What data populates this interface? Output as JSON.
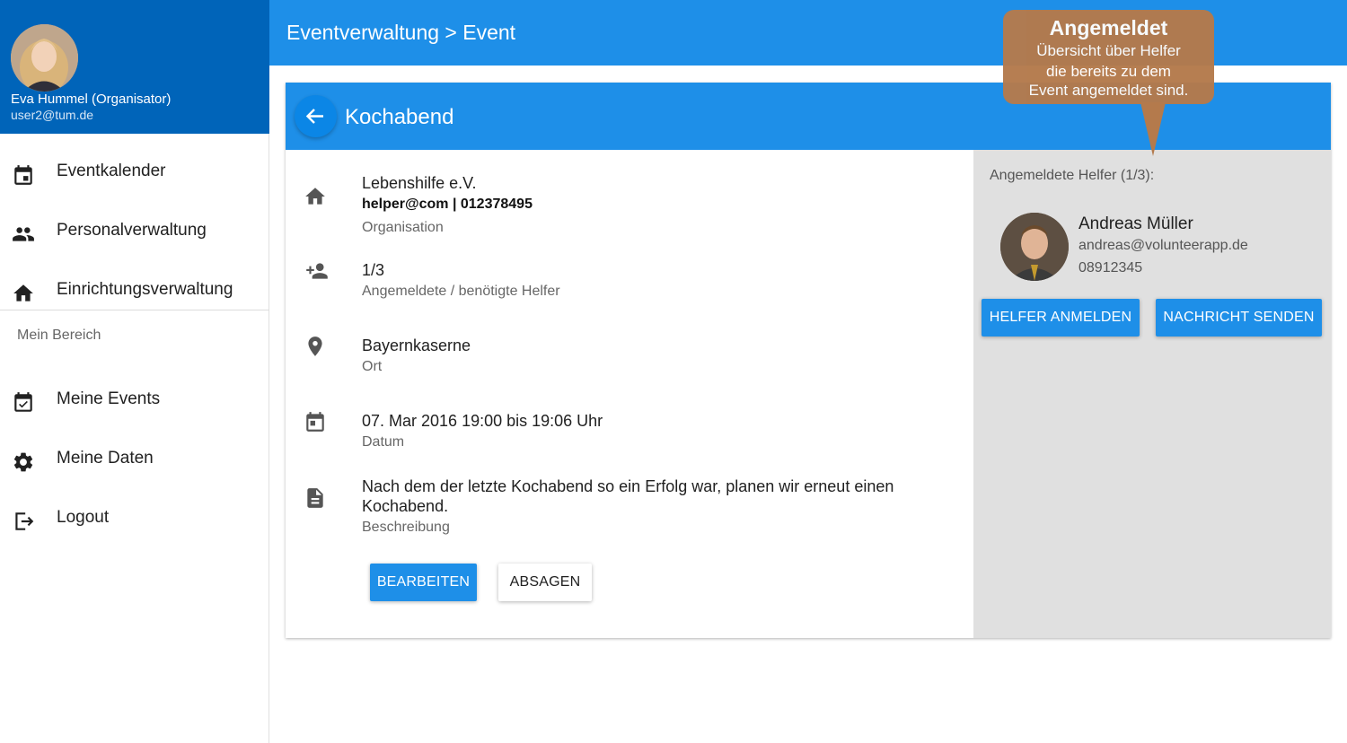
{
  "sidebar": {
    "profile": {
      "name": "Eva Hummel (Organisator)",
      "email": "user2@tum.de"
    },
    "nav": [
      {
        "label": "Eventkalender",
        "icon": "calendar-icon"
      },
      {
        "label": "Personalverwaltung",
        "icon": "people-icon"
      },
      {
        "label": "Einrichtungsverwaltung",
        "icon": "home-icon"
      }
    ],
    "section_label": "Mein Bereich",
    "personal": [
      {
        "label": "Meine Events",
        "icon": "calendar-check-icon"
      },
      {
        "label": "Meine Daten",
        "icon": "gear-icon"
      },
      {
        "label": "Logout",
        "icon": "logout-icon"
      }
    ]
  },
  "topbar": {
    "title": "Eventverwaltung > Event"
  },
  "event": {
    "title": "Kochabend",
    "organisation": {
      "name": "Lebenshilfe e.V.",
      "contact": "helper@com | 012378495",
      "label": "Organisation"
    },
    "helpers": {
      "value": "1/3",
      "label": "Angemeldete / benötigte Helfer"
    },
    "location": {
      "value": "Bayernkaserne",
      "label": "Ort"
    },
    "date": {
      "value": "07. Mar 2016 19:00 bis 19:06 Uhr",
      "label": "Datum"
    },
    "description": {
      "line1": "Nach dem der letzte Kochabend so ein Erfolg war, planen wir erneut einen",
      "line2": "Kochabend.",
      "label": "Beschreibung"
    },
    "buttons": {
      "edit": "BEARBEITEN",
      "cancel": "ABSAGEN"
    }
  },
  "panel": {
    "title": "Angemeldete Helfer (1/3):",
    "helper": {
      "name": "Andreas Müller",
      "email": "andreas@volunteerapp.de",
      "phone": "08912345"
    },
    "buttons": {
      "register": "HELFER ANMELDEN",
      "message": "NACHRICHT SENDEN"
    }
  },
  "annotation": {
    "title": "Angemeldet",
    "line1": "Übersicht über Helfer",
    "line2": "die bereits zu dem",
    "line3": "Event angemeldet sind."
  },
  "colors": {
    "primary": "#1e8fe8",
    "profile_bg": "#0064b9",
    "panel_bg": "#e0e0e0",
    "annotation": "#b47a4c"
  }
}
